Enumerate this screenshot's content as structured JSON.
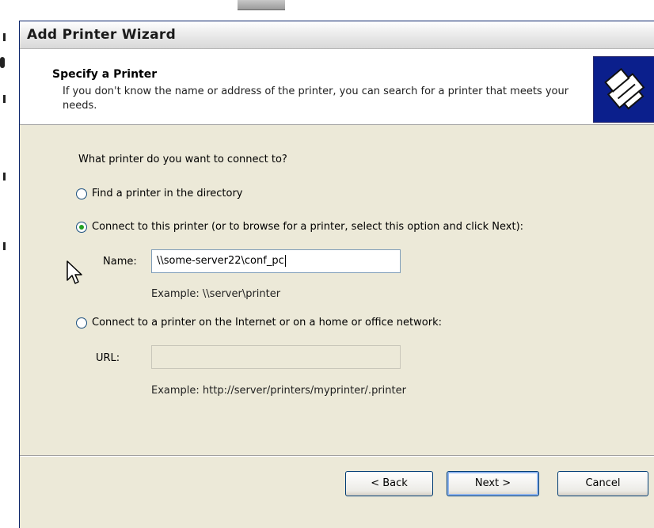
{
  "window": {
    "title": "Add Printer Wizard"
  },
  "header": {
    "title": "Specify a Printer",
    "description": "If you don't know the name or address of the printer, you can search for a printer that meets your needs.",
    "icon": "printer-icon"
  },
  "main": {
    "question": "What printer do you want to connect to?",
    "options": [
      {
        "label": "Find a printer in the directory",
        "mnemonic": "F",
        "selected": false
      },
      {
        "label": "Connect to this printer (or to browse for a printer, select this option and click Next):",
        "mnemonic": "C",
        "selected": true
      },
      {
        "label": "Connect to a printer on the Internet or on a home or office network:",
        "mnemonic": "o",
        "selected": false
      }
    ],
    "name_field": {
      "label": "Name:",
      "value": "\\\\some-server22\\conf_pc",
      "example": "Example: \\\\server\\printer"
    },
    "url_field": {
      "label": "URL:",
      "value": "",
      "example": "Example: http://server/printers/myprinter/.printer"
    }
  },
  "buttons": {
    "back": "< Back",
    "next": "Next >",
    "cancel": "Cancel"
  },
  "colors": {
    "window_bg": "#ece9d8",
    "header_icon_bg": "#0b1f8c",
    "radio_selected": "#21a121",
    "button_border": "#003c74"
  }
}
